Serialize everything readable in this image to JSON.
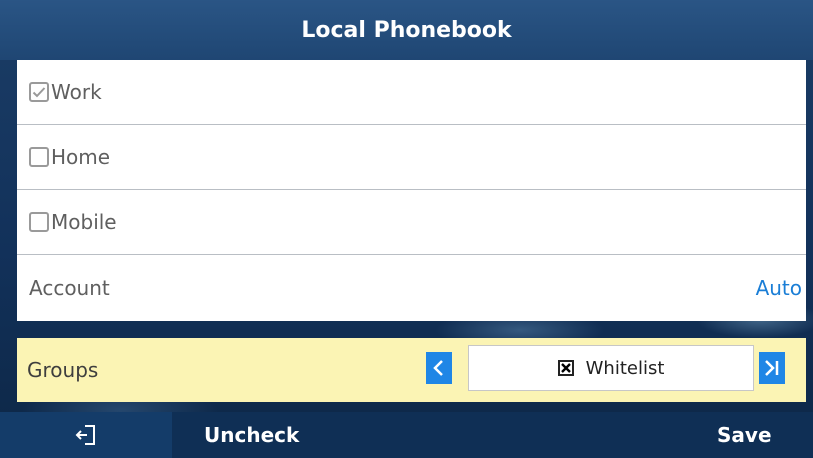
{
  "title": "Local Phonebook",
  "options": [
    {
      "label": "Work",
      "checked": true
    },
    {
      "label": "Home",
      "checked": false
    },
    {
      "label": "Mobile",
      "checked": false
    }
  ],
  "account": {
    "label": "Account",
    "value": "Auto"
  },
  "groups": {
    "label": "Groups",
    "selected": "Whitelist"
  },
  "softkeys": {
    "back_icon": "exit-icon",
    "uncheck": "Uncheck",
    "save": "Save"
  },
  "colors": {
    "accent": "#1f86e6",
    "highlight_row": "#fbf4b4",
    "title_bar": "#2a5585"
  }
}
